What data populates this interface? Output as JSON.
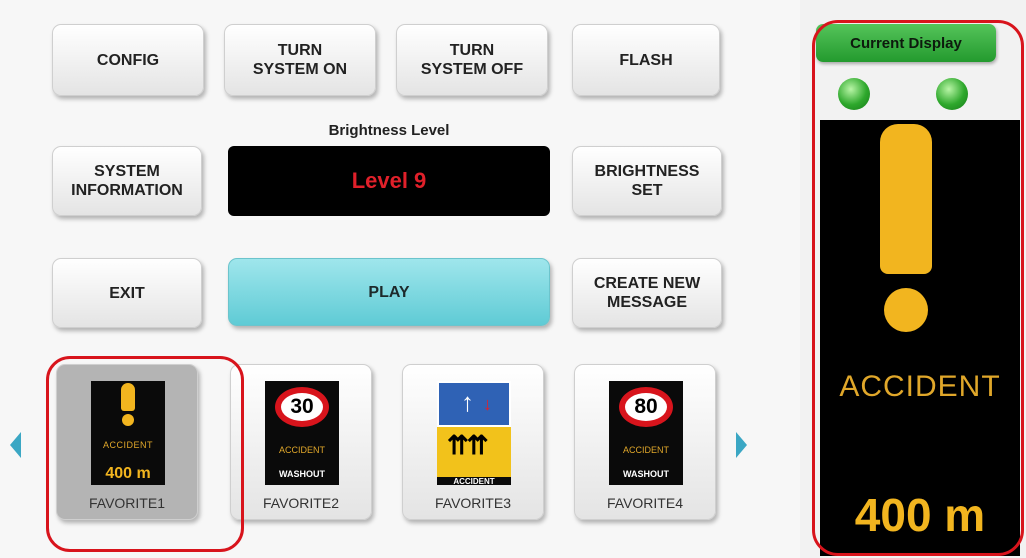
{
  "buttons": {
    "config": "CONFIG",
    "turn_on": "TURN\nSYSTEM ON",
    "turn_off": "TURN\nSYSTEM OFF",
    "flash": "FLASH",
    "system_info": "SYSTEM\nINFORMATION",
    "brightness_set": "BRIGHTNESS\nSET",
    "exit": "EXIT",
    "play": "PLAY",
    "create_message": "CREATE NEW\nMESSAGE"
  },
  "brightness": {
    "label": "Brightness Level",
    "value": "Level 9",
    "value_color": "#e0202a"
  },
  "favorites": [
    {
      "label": "FAVORITE1",
      "selected": true,
      "sign": {
        "type": "warning",
        "icon": "exclamation-icon",
        "text": "ACCIDENT",
        "distance": "400 m"
      }
    },
    {
      "label": "FAVORITE2",
      "selected": false,
      "sign": {
        "type": "speed-limit",
        "speed": "30",
        "text": "ACCIDENT",
        "subtext": "WASHOUT"
      }
    },
    {
      "label": "FAVORITE3",
      "selected": false,
      "sign": {
        "type": "lane-closure",
        "text": "ACCIDENT"
      }
    },
    {
      "label": "FAVORITE4",
      "selected": false,
      "sign": {
        "type": "speed-limit",
        "speed": "80",
        "text": "ACCIDENT",
        "subtext": "WASHOUT"
      }
    }
  ],
  "current_display": {
    "label": "Current Display",
    "leds": [
      "on",
      "on"
    ],
    "sign": {
      "icon": "exclamation-icon",
      "text": "ACCIDENT",
      "distance": "400 m"
    }
  },
  "colors": {
    "accent_play": "#5fcbd5",
    "amber": "#f2b51f",
    "highlight_red": "#d8141c",
    "led_green": "#2ea82c",
    "nav_arrow": "#3ba7c4"
  }
}
